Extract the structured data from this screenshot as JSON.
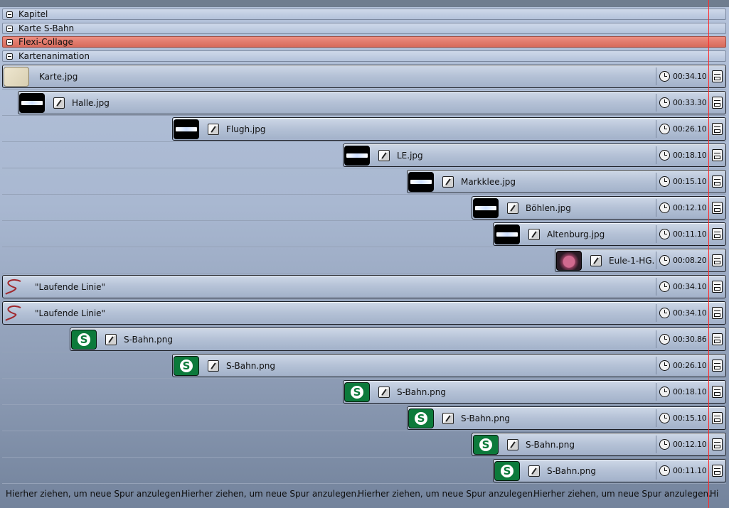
{
  "groups": [
    {
      "title": "Kapitel"
    },
    {
      "title": "Karte S-Bahn"
    },
    {
      "title": "Flexi-Collage"
    },
    {
      "title": "Kartenanimation"
    }
  ],
  "tracks": [
    {
      "name": "Karte.jpg",
      "duration": "00:34.10",
      "thumb": "map"
    },
    {
      "name": "Halle.jpg",
      "duration": "00:33.30",
      "thumb": "photo"
    },
    {
      "name": "Flugh.jpg",
      "duration": "00:26.10",
      "thumb": "photo"
    },
    {
      "name": "LE.jpg",
      "duration": "00:18.10",
      "thumb": "photo"
    },
    {
      "name": "Markklee.jpg",
      "duration": "00:15.10",
      "thumb": "photo"
    },
    {
      "name": "Böhlen.jpg",
      "duration": "00:12.10",
      "thumb": "photo"
    },
    {
      "name": "Altenburg.jpg",
      "duration": "00:11.10",
      "thumb": "photo"
    },
    {
      "name": "Eule-1-HG.",
      "duration": "00:08.20",
      "thumb": "owl"
    },
    {
      "name": "\"Laufende Linie\"",
      "duration": "00:34.10",
      "thumb": "line"
    },
    {
      "name": "\"Laufende Linie\"",
      "duration": "00:34.10",
      "thumb": "line"
    },
    {
      "name": "S-Bahn.png",
      "duration": "00:30.86",
      "thumb": "sbahn"
    },
    {
      "name": "S-Bahn.png",
      "duration": "00:26.10",
      "thumb": "sbahn"
    },
    {
      "name": "S-Bahn.png",
      "duration": "00:18.10",
      "thumb": "sbahn"
    },
    {
      "name": "S-Bahn.png",
      "duration": "00:15.10",
      "thumb": "sbahn"
    },
    {
      "name": "S-Bahn.png",
      "duration": "00:12.10",
      "thumb": "sbahn"
    },
    {
      "name": "S-Bahn.png",
      "duration": "00:11.10",
      "thumb": "sbahn"
    }
  ],
  "footer": {
    "hints": [
      "Hierher ziehen, um neue Spur anzulegen.",
      "Hierher ziehen, um neue Spur anzulegen.",
      "Hierher ziehen, um neue Spur anzulegen.",
      "Hierher ziehen, um neue Spur anzulegen.",
      "Hi"
    ]
  },
  "colors": {
    "active_group": "#d76a5b",
    "playhead": "#ff2a2a",
    "sbahn_green": "#0c7a3b"
  },
  "icons": {
    "group_toggle": "minus-box-icon",
    "effect": "effect-icon",
    "duration": "clock-icon",
    "end_marker": "end-marker-icon"
  }
}
